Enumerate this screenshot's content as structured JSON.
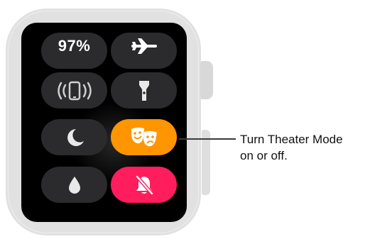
{
  "control_center": {
    "battery_label": "97%",
    "tiles": [
      {
        "name": "battery",
        "icon": "battery-text"
      },
      {
        "name": "airplane-mode",
        "icon": "airplane-icon"
      },
      {
        "name": "ping-iphone",
        "icon": "ping-iphone-icon"
      },
      {
        "name": "flashlight",
        "icon": "flashlight-icon"
      },
      {
        "name": "do-not-disturb",
        "icon": "moon-icon"
      },
      {
        "name": "theater-mode",
        "icon": "theater-masks-icon",
        "active": true,
        "color": "#ff9500"
      },
      {
        "name": "water-lock",
        "icon": "water-drop-icon"
      },
      {
        "name": "silent-mode",
        "icon": "bell-slash-icon",
        "active": true,
        "color": "#ff1d5e"
      }
    ]
  },
  "callout": {
    "line1": "Turn Theater Mode",
    "line2": "on or off."
  },
  "colors": {
    "tile_background": "#2b2b2d",
    "screen": "#000000",
    "case": "#e1e1e1"
  }
}
